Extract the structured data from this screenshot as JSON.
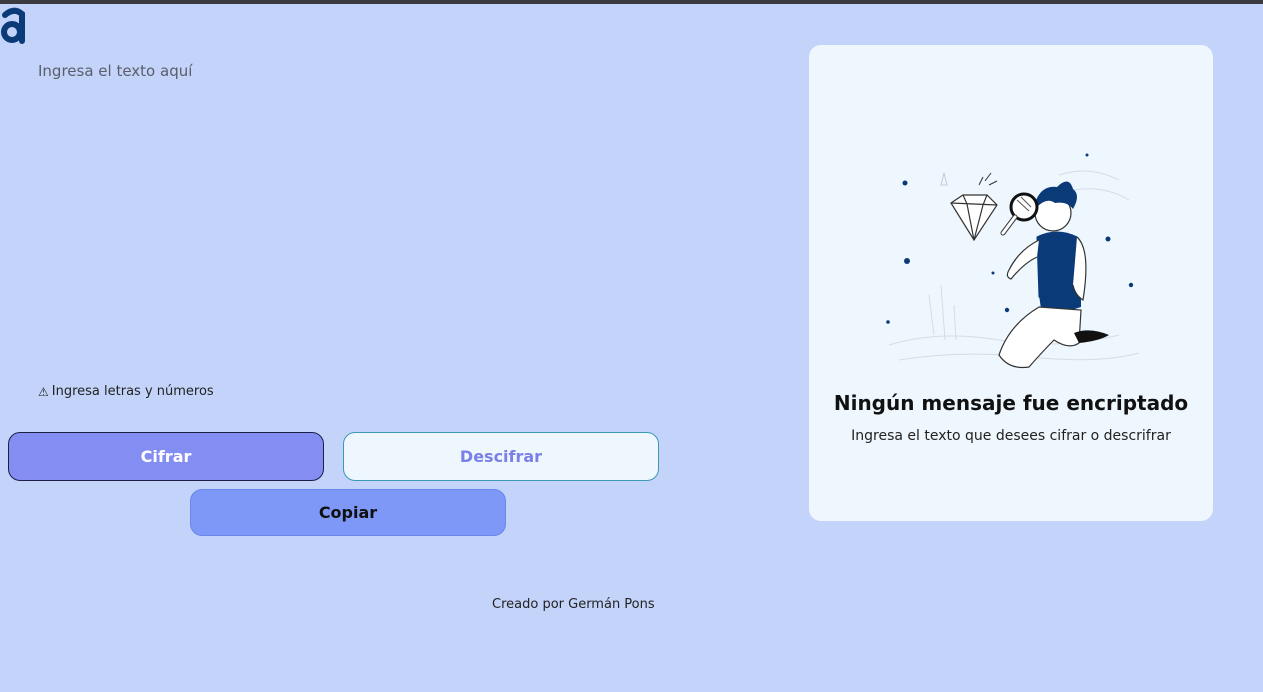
{
  "app": {
    "logo_icon": "alura-a-logo-icon",
    "accent_color": "#848df2"
  },
  "input": {
    "placeholder": "Ingresa el texto aquí",
    "value": ""
  },
  "hint": {
    "icon": "warning-icon",
    "glyph": "⚠",
    "text": "Ingresa letras y números"
  },
  "buttons": {
    "encrypt_label": "Cifrar",
    "decrypt_label": "Descifrar",
    "copy_label": "Copiar"
  },
  "output_panel": {
    "illustration": "person-with-magnifying-glass-illustration",
    "title": "Ningún mensaje fue encriptado",
    "subtitle": "Ingresa el texto que desees cifrar o descrifrar"
  },
  "footer": {
    "credit": "Creado por Germán Pons"
  }
}
